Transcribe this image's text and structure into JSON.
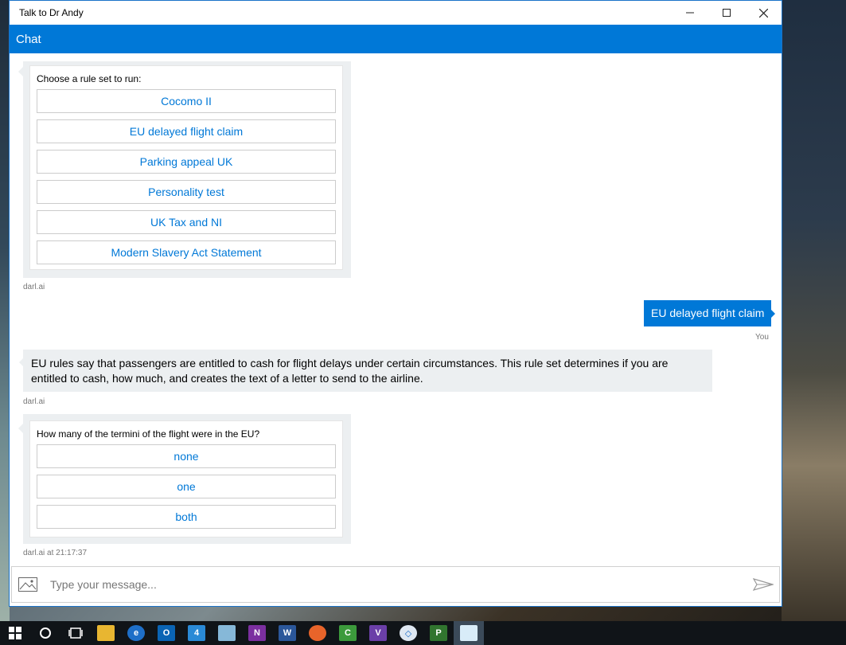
{
  "window": {
    "title": "Talk to Dr Andy",
    "header_title": "Chat",
    "controls": [
      "minimize",
      "maximize",
      "close"
    ]
  },
  "chat": {
    "rule_card": {
      "prompt": "Choose a rule set to run:",
      "options": [
        "Cocomo II",
        "EU delayed flight claim",
        "Parking appeal UK",
        "Personality test",
        "UK Tax and NI",
        "Modern Slavery Act Statement"
      ],
      "sender": "darl.ai"
    },
    "user_message": {
      "text": "EU delayed flight claim",
      "sender": "You"
    },
    "bot_message": {
      "text": "EU rules say that passengers are entitled to cash for flight delays under certain circumstances. This rule set determines if you are entitled to cash, how much, and creates the text of a letter to send to the airline.",
      "sender": "darl.ai"
    },
    "termini_card": {
      "prompt": "How many of the termini of the flight were in the EU?",
      "options": [
        "none",
        "one",
        "both"
      ],
      "sender": "darl.ai at 21:17:37"
    }
  },
  "input": {
    "placeholder": "Type your message...",
    "value": ""
  },
  "colors": {
    "accent": "#0078d7",
    "bubble_gray": "#eceff1",
    "taskbar": "#101418"
  },
  "taskbar": {
    "icons": [
      "windows-start-icon",
      "search-circle-icon",
      "task-view-icon",
      "file-explorer-icon",
      "edge-icon",
      "outlook-icon",
      "app-icon",
      "notepad-icon",
      "onenote-icon",
      "word-icon",
      "firefox-icon",
      "camtasia-icon",
      "visual-studio-icon",
      "remote-icon",
      "project-icon",
      "chat-app-icon"
    ]
  }
}
